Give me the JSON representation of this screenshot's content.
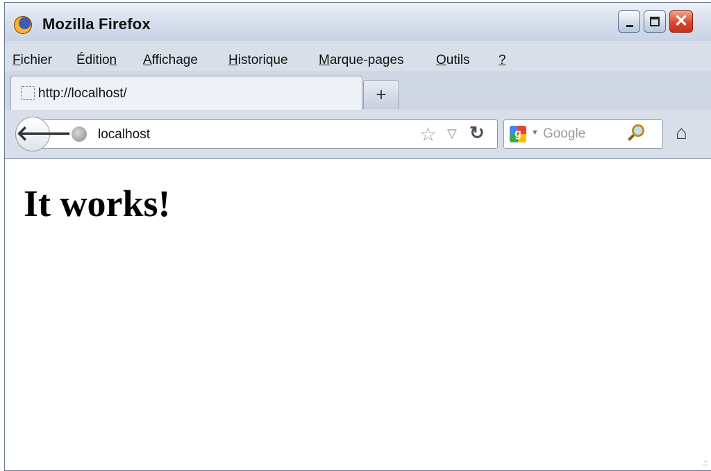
{
  "window": {
    "title": "Mozilla Firefox",
    "controls": {
      "minimize": "–",
      "maximize": "□",
      "close": "✕"
    }
  },
  "menu": [
    {
      "pre": "",
      "ul": "F",
      "post": "ichier"
    },
    {
      "pre": "Éditio",
      "ul": "n",
      "post": ""
    },
    {
      "pre": "",
      "ul": "A",
      "post": "ffichage"
    },
    {
      "pre": "",
      "ul": "H",
      "post": "istorique"
    },
    {
      "pre": "",
      "ul": "M",
      "post": "arque-pages"
    },
    {
      "pre": "",
      "ul": "O",
      "post": "utils"
    },
    {
      "pre": "",
      "ul": "?",
      "post": ""
    }
  ],
  "tabs": {
    "active": {
      "label": "http://localhost/"
    },
    "new_tab_label": "+"
  },
  "navbar": {
    "back_glyph": "🡐",
    "url": "localhost",
    "bookmark_star": "☆",
    "url_dropdown": "▽",
    "reload_glyph": "↻",
    "search": {
      "engine_letter": "g",
      "dropdown": "▼",
      "placeholder": "Google"
    },
    "home_glyph": "⌂"
  },
  "page": {
    "heading": "It works!",
    "resize_grip": ".::"
  },
  "colors": {
    "chrome_bg": "#d9dfe9",
    "close_button": "#d8472c",
    "content_bg": "#ffffff"
  }
}
